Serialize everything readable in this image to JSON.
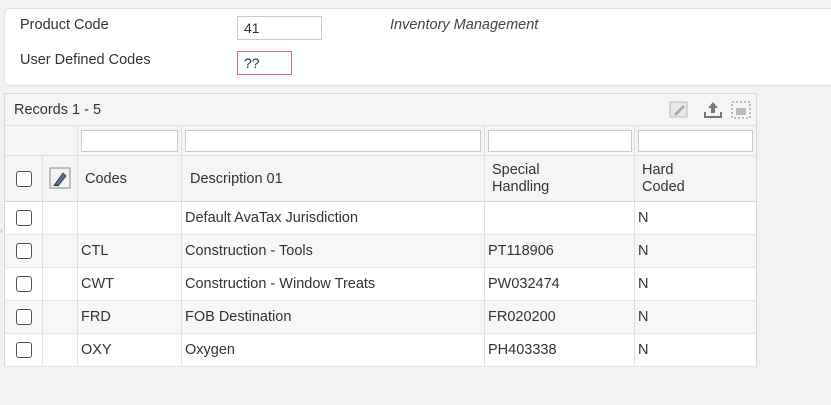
{
  "form": {
    "product_code_label": "Product Code",
    "product_code_value": "41",
    "product_description": "Inventory Management",
    "udc_label": "User Defined Codes",
    "udc_value": "??"
  },
  "grid": {
    "records_label": "Records 1 - 5",
    "columns": {
      "codes": "Codes",
      "description": "Description 01",
      "special_handling_1": "Special",
      "special_handling_2": "Handling",
      "hard_coded_1": "Hard",
      "hard_coded_2": "Coded"
    },
    "rows": [
      {
        "code": "",
        "description": "Default AvaTax Jurisdiction",
        "special": "",
        "hard": "N"
      },
      {
        "code": "CTL",
        "description": "Construction - Tools",
        "special": "PT118906",
        "hard": "N"
      },
      {
        "code": "CWT",
        "description": "Construction - Window Treats",
        "special": "PW032474",
        "hard": "N"
      },
      {
        "code": "FRD",
        "description": "FOB Destination",
        "special": "FR020200",
        "hard": "N"
      },
      {
        "code": "OXY",
        "description": "Oxygen",
        "special": "PH403338",
        "hard": "N"
      }
    ]
  }
}
